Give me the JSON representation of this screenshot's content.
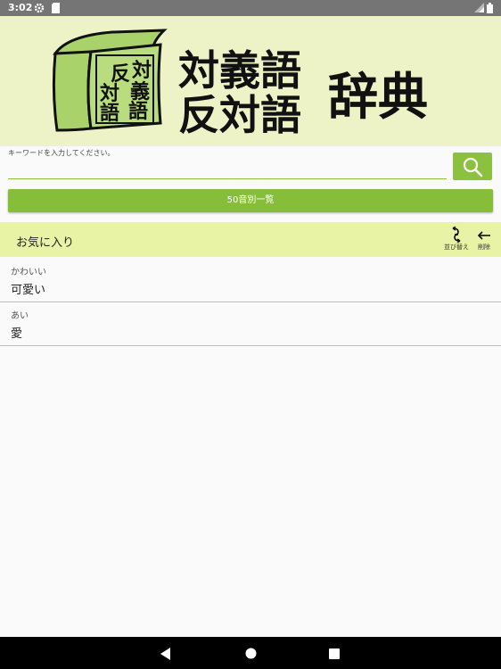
{
  "status_bar": {
    "time": "3:02",
    "icons": [
      "gear-icon",
      "sd-card-icon",
      "signal-icon",
      "battery-icon"
    ]
  },
  "banner": {
    "book_lines": [
      "反",
      "対",
      "対",
      "義",
      "語",
      "語"
    ],
    "title_line1": "対義語",
    "title_line2": "反対語",
    "title_side": "辞典"
  },
  "search": {
    "hint": "キーワードを入力してください。",
    "value": "",
    "placeholder": ""
  },
  "gojuon_button_label": "50音別一覧",
  "favorites": {
    "title": "お気に入り",
    "sort_label": "並び替え",
    "delete_label": "削除",
    "items": [
      {
        "reading": "かわいい",
        "word": "可愛い"
      },
      {
        "reading": "あい",
        "word": "愛"
      }
    ]
  },
  "colors": {
    "banner_bg": "#edf3c7",
    "accent_green": "#86be3a",
    "favorites_header_bg": "#e9f3a6"
  }
}
